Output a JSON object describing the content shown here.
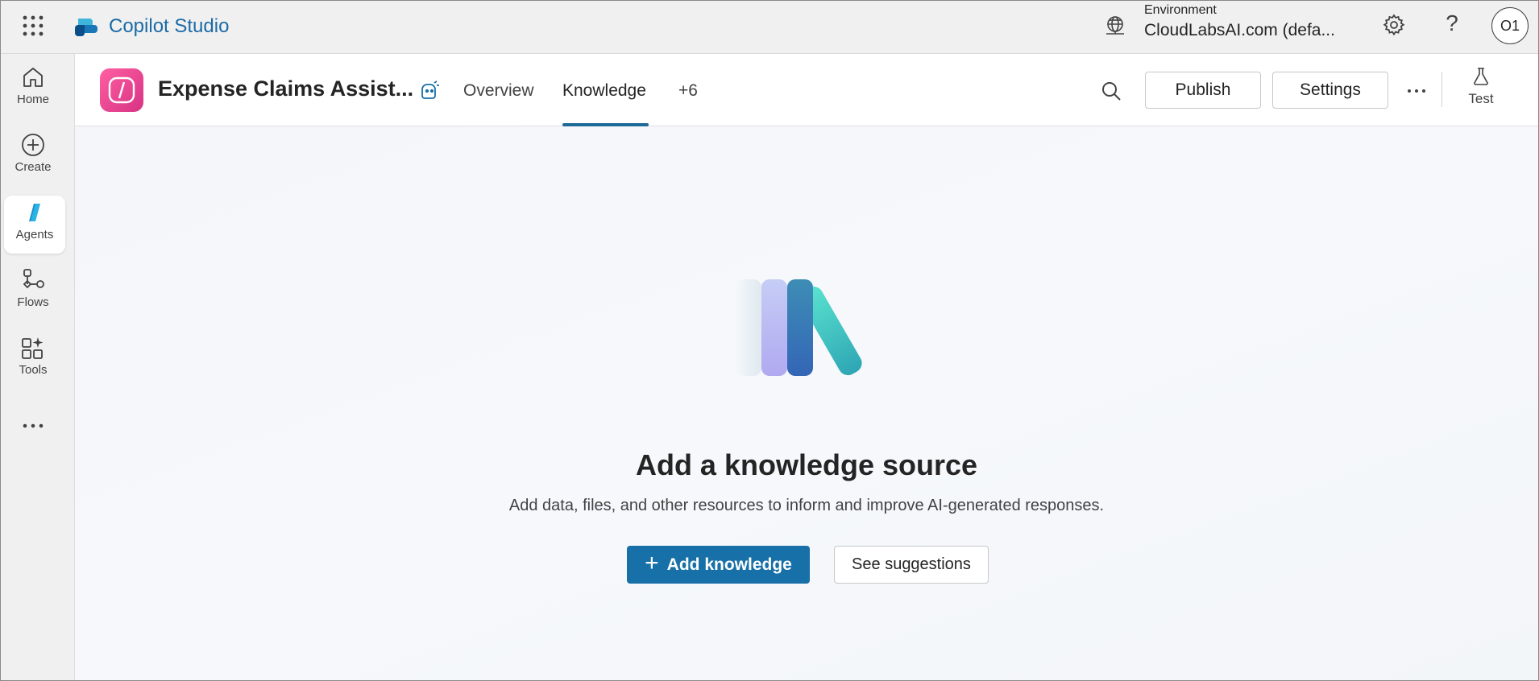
{
  "topbar": {
    "brand": "Copilot Studio",
    "environment_label": "Environment",
    "environment_value": "CloudLabsAI.com (defa...",
    "avatar_initials": "O1",
    "help_glyph": "?",
    "icons": [
      "app-launcher-icon",
      "copilot-studio-logo",
      "environment-globe-icon",
      "gear-icon",
      "help-icon"
    ]
  },
  "leftnav": {
    "items": [
      {
        "label": "Home",
        "icon": "home-icon"
      },
      {
        "label": "Create",
        "icon": "add-circle-icon"
      },
      {
        "label": "Agents",
        "icon": "agents-icon",
        "active": true
      },
      {
        "label": "Flows",
        "icon": "flows-icon"
      },
      {
        "label": "Tools",
        "icon": "tools-icon"
      }
    ],
    "more_icon": "more-horizontal-icon"
  },
  "agentbar": {
    "name": "Expense Claims Assist...",
    "tabs": [
      {
        "label": "Overview",
        "active": false
      },
      {
        "label": "Knowledge",
        "active": true
      },
      {
        "label": "+6",
        "active": false
      }
    ],
    "publish_label": "Publish",
    "settings_label": "Settings",
    "test_label": "Test"
  },
  "main": {
    "title": "Add a knowledge source",
    "subtitle": "Add data, files, and other resources to inform and improve AI-generated responses.",
    "primary_button": "Add knowledge",
    "secondary_button": "See suggestions"
  },
  "colors": {
    "accent": "#1770a8",
    "agent_icon": "#e0428f",
    "topbar_bg": "#f0f0f0",
    "main_bg": "#f4f6fa"
  }
}
